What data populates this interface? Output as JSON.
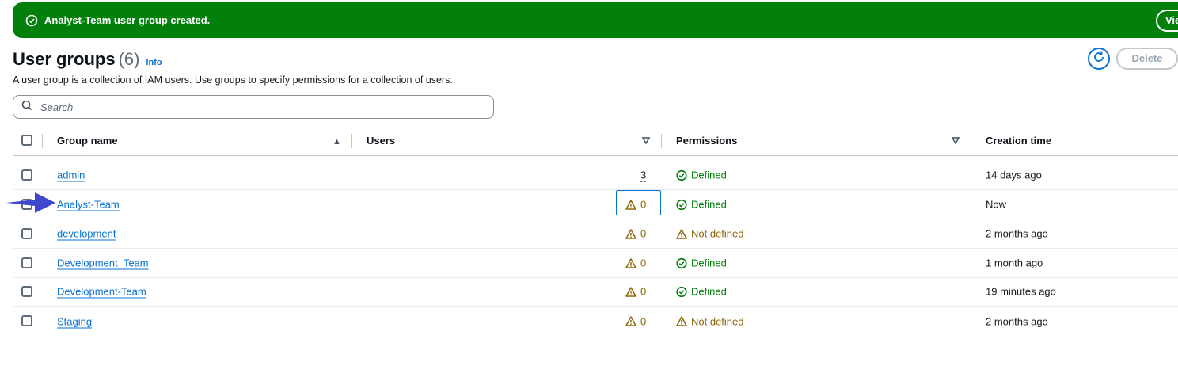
{
  "flash": {
    "message": "Analyst-Team user group created.",
    "view_label": "View group"
  },
  "header": {
    "title": "User groups",
    "count": "(6)",
    "info": "Info",
    "description": "A user group is a collection of IAM users. Use groups to specify permissions for a collection of users.",
    "delete_label": "Delete"
  },
  "search": {
    "placeholder": "Search"
  },
  "table": {
    "columns": {
      "group_name": "Group name",
      "users": "Users",
      "permissions": "Permissions",
      "creation_time": "Creation time"
    },
    "rows": [
      {
        "name": "admin",
        "users": "3",
        "users_warning": false,
        "permissions": "Defined",
        "perm_ok": true,
        "created": "14 days ago"
      },
      {
        "name": "Analyst-Team",
        "users": "0",
        "users_warning": true,
        "permissions": "Defined",
        "perm_ok": true,
        "created": "Now"
      },
      {
        "name": "development",
        "users": "0",
        "users_warning": true,
        "permissions": "Not defined",
        "perm_ok": false,
        "created": "2 months ago"
      },
      {
        "name": "Development_Team",
        "users": "0",
        "users_warning": true,
        "permissions": "Defined",
        "perm_ok": true,
        "created": "1 month ago"
      },
      {
        "name": "Development-Team",
        "users": "0",
        "users_warning": true,
        "permissions": "Defined",
        "perm_ok": true,
        "created": "19 minutes ago"
      },
      {
        "name": "Staging",
        "users": "0",
        "users_warning": true,
        "permissions": "Not defined",
        "perm_ok": false,
        "created": "2 months ago"
      }
    ]
  },
  "colors": {
    "success": "#037f0c",
    "warning": "#8d6605",
    "link": "#0972d3",
    "annotation_arrow": "#3f48cc"
  },
  "icons": [
    "success-check-icon",
    "info-link",
    "refresh-icon",
    "search-icon",
    "sort-ascending-icon",
    "sort-icon",
    "warning-icon",
    "annotation-arrow-icon"
  ]
}
